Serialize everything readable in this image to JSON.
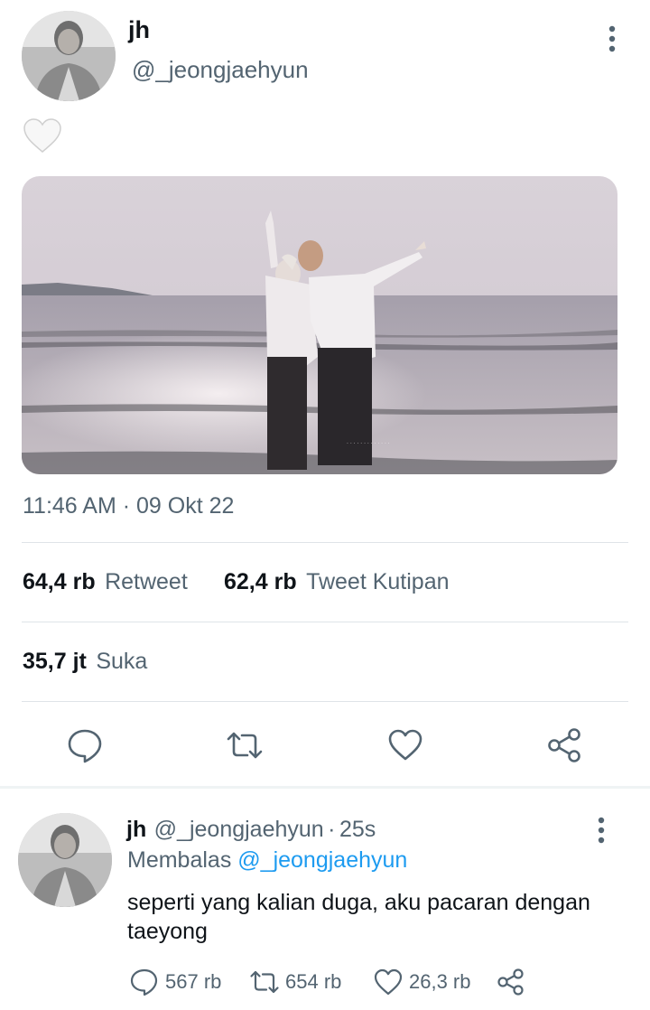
{
  "tweet": {
    "author_name": "jh",
    "author_handle": "@_jeongjaehyun",
    "body_emoji": "white-heart-emoji",
    "timestamp": "11:46 AM · 09 Okt 22",
    "stats": {
      "retweet_count": "64,4 rb",
      "retweet_label": "Retweet",
      "quote_count": "62,4 rb",
      "quote_label": "Tweet Kutipan",
      "like_count": "35,7 jt",
      "like_label": "Suka"
    },
    "actions": [
      "reply-icon",
      "retweet-icon",
      "like-icon",
      "share-icon"
    ]
  },
  "reply": {
    "author_name": "jh",
    "author_handle": "@_jeongjaehyun",
    "separator": "·",
    "age": "25s",
    "replying_prefix": "Membalas",
    "replying_to": "@_jeongjaehyun",
    "text": "seperti yang kalian duga, aku pacaran dengan taeyong",
    "reply_count": "567 rb",
    "retweet_count": "654 rb",
    "like_count": "26,3 rb"
  },
  "colors": {
    "primary_text": "#0f1419",
    "secondary_text": "#536471",
    "link": "#1d9bf0",
    "divider": "#dfe4e8"
  }
}
